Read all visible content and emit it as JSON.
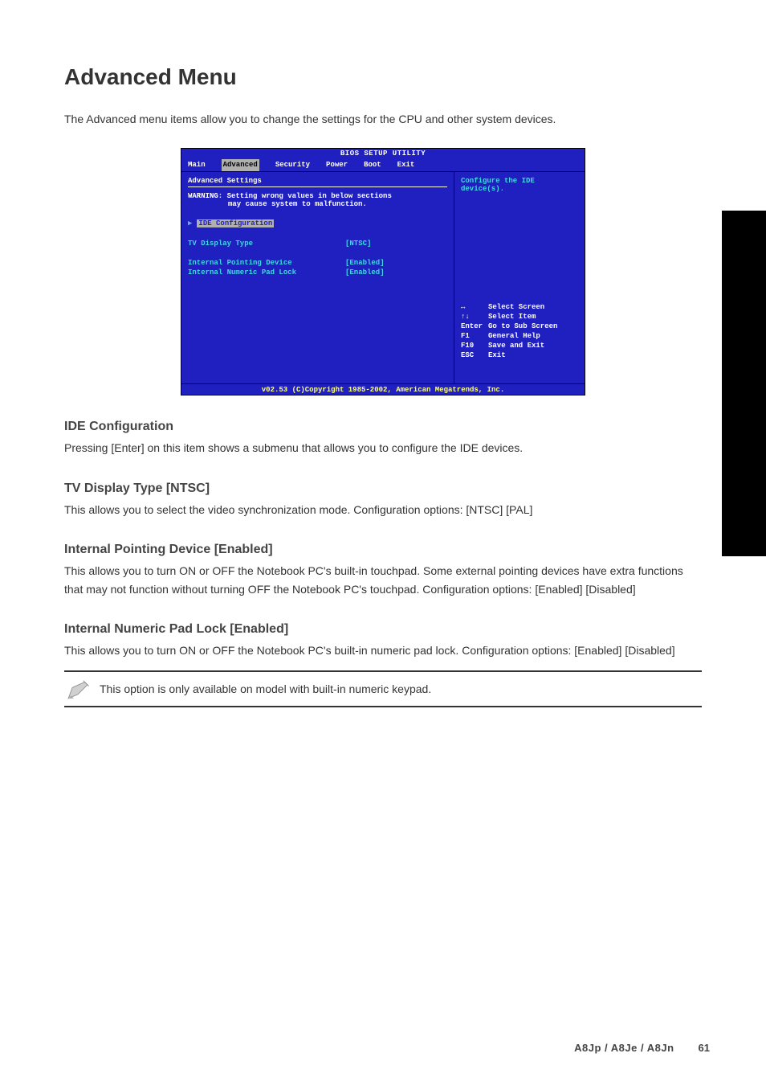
{
  "page": {
    "title": "Advanced Menu",
    "intro": "The Advanced menu items allow you to change the settings for the CPU and other system devices.",
    "footer_model": "A8Jp / A8Je / A8Jn",
    "footer_num": "61"
  },
  "bios": {
    "title": "BIOS SETUP UTILITY",
    "tabs": [
      "Main",
      "Advanced",
      "Security",
      "Power",
      "Boot",
      "Exit"
    ],
    "active_tab": "Advanced",
    "section_title": "Advanced Settings",
    "warning_line1": "WARNING: Setting wrong values in below sections",
    "warning_line2": "may cause system to malfunction.",
    "submenu": "IDE Configuration",
    "option1_label": "TV Display Type",
    "option1_value": "[NTSC]",
    "option2_label": "Internal Pointing Device",
    "option2_value": "[Enabled]",
    "option3_label": "Internal Numeric Pad Lock",
    "option3_value": "[Enabled]",
    "help_text": "Configure the IDE device(s).",
    "keys": [
      {
        "k": "↔",
        "t": "Select Screen"
      },
      {
        "k": "↑↓",
        "t": "Select Item"
      },
      {
        "k": "Enter",
        "t": "Go to Sub Screen"
      },
      {
        "k": "F1",
        "t": "General Help"
      },
      {
        "k": "F10",
        "t": "Save and Exit"
      },
      {
        "k": "ESC",
        "t": "Exit"
      }
    ],
    "footer": "v02.53 (C)Copyright 1985-2002, American Megatrends, Inc."
  },
  "sections": [
    {
      "heading": "IDE Configuration",
      "body": "Pressing [Enter] on this item shows a submenu that allows you to configure the IDE devices."
    },
    {
      "heading": "TV Display Type [NTSC]",
      "body": "This allows you to select the video synchronization mode. Configuration options: [NTSC] [PAL]"
    },
    {
      "heading": "Internal Pointing Device [Enabled]",
      "body": "This allows you to turn ON or OFF the Notebook PC's built-in touchpad. Some external pointing devices have extra functions that may not function without turning OFF the Notebook PC's touchpad. Configuration options: [Enabled] [Disabled]"
    },
    {
      "heading": "Internal Numeric Pad Lock [Enabled]",
      "body": "This allows you to turn ON or OFF the Notebook PC's built-in numeric pad lock. Configuration options: [Enabled] [Disabled]"
    }
  ],
  "note": {
    "text": "This option is only available on model with built-in numeric keypad."
  }
}
